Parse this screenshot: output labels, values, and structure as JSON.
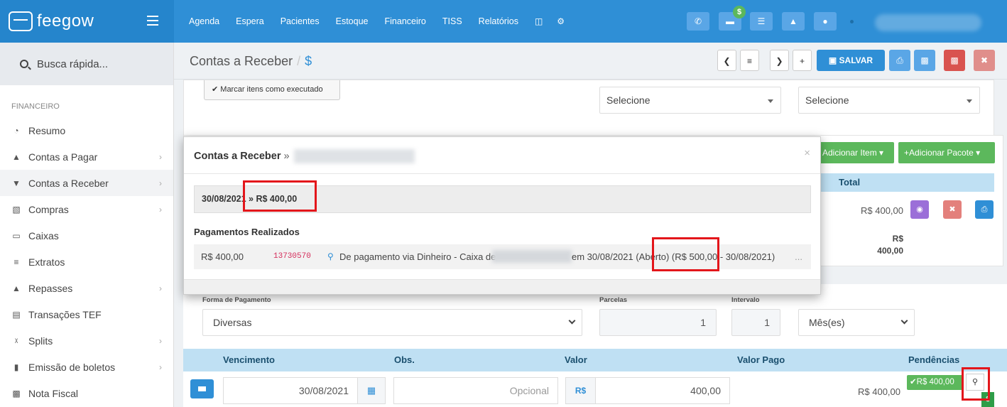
{
  "topbar": {
    "brand": "feegow",
    "nav": [
      "Agenda",
      "Espera",
      "Pacientes",
      "Estoque",
      "Financeiro",
      "TISS",
      "Relatórios"
    ],
    "badge": "$"
  },
  "sidebar": {
    "search_label": "Busca rápida...",
    "section_title": "FINANCEIRO",
    "items": [
      {
        "label": "Resumo",
        "icon": "pie-chart-icon",
        "chevron": false
      },
      {
        "label": "Contas a Pagar",
        "icon": "arrow-up-circle-icon",
        "chevron": true
      },
      {
        "label": "Contas a Receber",
        "icon": "arrow-down-circle-icon",
        "chevron": true,
        "active": true
      },
      {
        "label": "Compras",
        "icon": "cart-icon",
        "chevron": true
      },
      {
        "label": "Caixas",
        "icon": "inbox-icon",
        "chevron": false
      },
      {
        "label": "Extratos",
        "icon": "list-icon",
        "chevron": false
      },
      {
        "label": "Repasses",
        "icon": "sitemap-icon",
        "chevron": true
      },
      {
        "label": "Transações TEF",
        "icon": "credit-card-icon",
        "chevron": false
      },
      {
        "label": "Splits",
        "icon": "split-icon",
        "chevron": true
      },
      {
        "label": "Emissão de boletos",
        "icon": "barcode-icon",
        "chevron": true
      },
      {
        "label": "Nota Fiscal",
        "icon": "file-icon",
        "chevron": false
      }
    ]
  },
  "page": {
    "title": "Contas a Receber",
    "title_sub": "$",
    "save_label": "SALVAR"
  },
  "form_top": {
    "mark_executed": "Marcar itens como executado",
    "select1_value": "Selecione",
    "select2_value": "Selecione"
  },
  "items_panel": {
    "add_item": "Adicionar Item",
    "add_package": "Adicionar Pacote",
    "total_header": "Total",
    "total_value": "R$ 400,00",
    "sum_currency": "R$",
    "sum_value": "400,00"
  },
  "payment": {
    "forma_label": "Forma de Pagamento",
    "forma_value": "Diversas",
    "parcelas_label": "Parcelas",
    "parcelas_value": "1",
    "intervalo_label": "Intervalo",
    "intervalo_value": "1",
    "periodo_value": "Mês(es)"
  },
  "installments": {
    "headers": [
      "Vencimento",
      "Obs.",
      "Valor",
      "Valor Pago",
      "Pendências"
    ],
    "date": "30/08/2021",
    "obs_placeholder": "Opcional",
    "currency": "R$",
    "valor": "400,00",
    "valor_pago": "R$ 400,00",
    "pendencia": "R$ 400,00"
  },
  "modal": {
    "title": "Contas a Receber",
    "title_arrow": "»",
    "close": "×",
    "summary": "30/08/2021 » R$ 400,00",
    "section": "Pagamentos Realizados",
    "payment": {
      "amount": "R$ 400,00",
      "code": "13730570",
      "desc_prefix": "De pagamento via Dinheiro - Caixa de",
      "desc_suffix": "em 30/08/2021 (Aberto) (R$ 500,00 - 30/08/2021)",
      "more": "..."
    }
  }
}
